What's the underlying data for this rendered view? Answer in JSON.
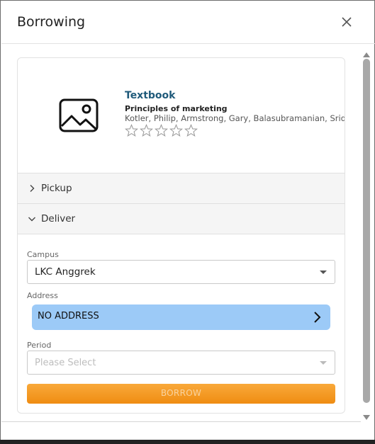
{
  "dialog": {
    "title": "Borrowing",
    "close_icon": "close-icon"
  },
  "book": {
    "image_icon": "image-placeholder-icon",
    "type": "Textbook",
    "title": "Principles of marketing",
    "authors": "Kotler, Philip, Armstrong, Gary, Balasubramanian, Sridhar",
    "rating": 0,
    "rating_max": 5
  },
  "accordion": {
    "pickup": {
      "label": "Pickup",
      "expanded": false
    },
    "deliver": {
      "label": "Deliver",
      "expanded": true
    }
  },
  "form": {
    "campus": {
      "label": "Campus",
      "value": "LKC Anggrek"
    },
    "address": {
      "label": "Address",
      "value": "NO ADDRESS"
    },
    "period": {
      "label": "Period",
      "placeholder": "Please Select",
      "value": ""
    },
    "borrow_label": "BORROW"
  },
  "colors": {
    "title_link": "#1f5a7a",
    "address_bg": "#9ccaf7",
    "borrow_bg": "#f39a24"
  }
}
